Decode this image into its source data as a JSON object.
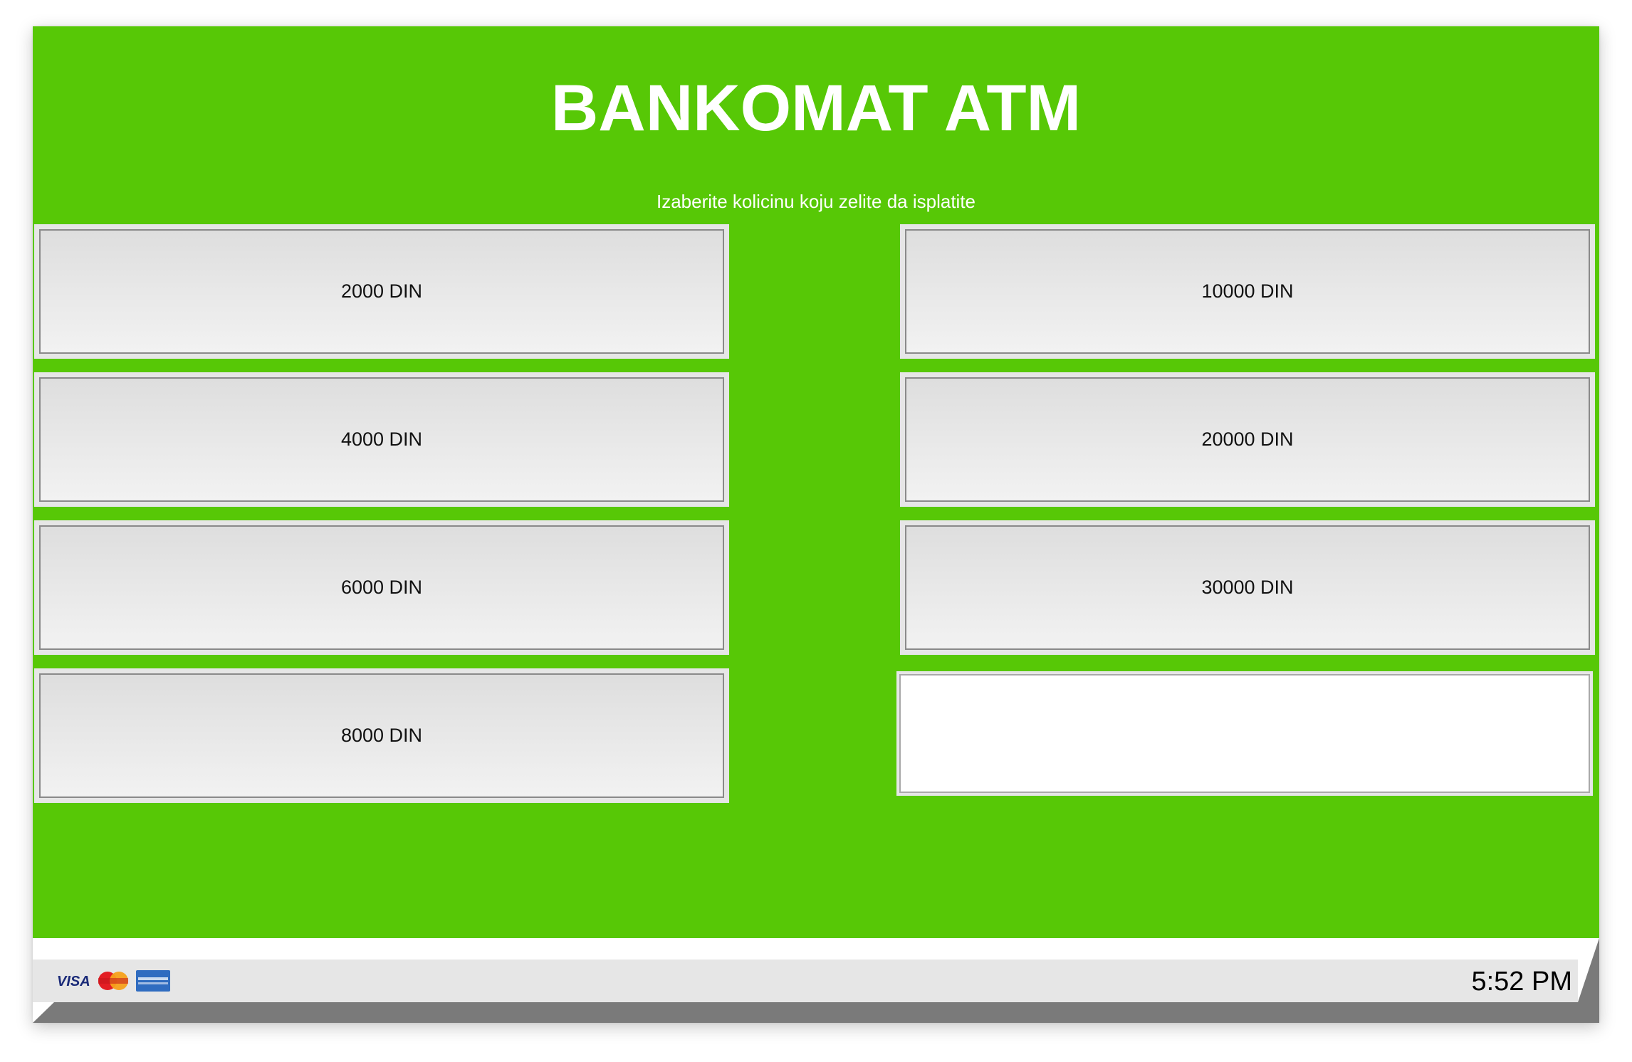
{
  "header": {
    "title": "BANKOMAT ATM",
    "subtitle": "Izaberite kolicinu koju zelite da isplatite"
  },
  "amounts": {
    "left": [
      "2000 DIN",
      "4000 DIN",
      "6000 DIN",
      "8000 DIN"
    ],
    "right": [
      "10000 DIN",
      "20000 DIN",
      "30000 DIN"
    ]
  },
  "footer": {
    "cards": [
      "visa-icon",
      "mastercard-icon",
      "american-express-icon"
    ],
    "clock": "5:52 PM"
  },
  "colors": {
    "screen_background": "#57c806",
    "button_background": "#efefef",
    "footer_bar": "#e6e6e6"
  }
}
